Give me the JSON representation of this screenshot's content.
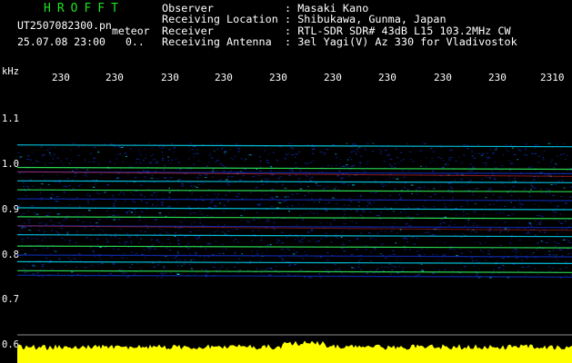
{
  "header": {
    "logo": "HROFFT",
    "filename": "UT2507082300.pn",
    "filetype": "meteor",
    "datetime": "25.07.08 23:00",
    "dots": "0..",
    "info": [
      {
        "label": "Observer",
        "value": ": Masaki Kano"
      },
      {
        "label": "Receiving Location",
        "value": ": Shibukawa, Gunma, Japan"
      },
      {
        "label": "Receiver",
        "value": ": RTL-SDR SDR# 43dB L15 103.2MHz CW"
      },
      {
        "label": "Receiving Antenna",
        "value": ": 3el Yagi(V) Az 330 for Vladivostok"
      }
    ]
  },
  "axes": {
    "y_unit": "kHz",
    "y_labels": [
      "1.1",
      "1.0",
      "0.9",
      "0.8",
      "0.7",
      "0.6"
    ],
    "x_labels": [
      "230",
      "230",
      "230",
      "230",
      "230",
      "230",
      "230",
      "230",
      "230",
      "230",
      "2310"
    ]
  },
  "colors": {
    "logo": "#1fe21f",
    "power_trace": "#ffff00",
    "baseline": "#c8c8c8",
    "signal_cyan": "#00e0ff",
    "signal_green": "#30ff60",
    "signal_red": "#ff3030",
    "noise_blue": "#1030c0"
  },
  "spectrogram": {
    "signal_lines_khz": [
      1.045,
      0.995,
      0.985,
      0.965,
      0.945,
      0.925,
      0.905,
      0.885,
      0.865,
      0.845,
      0.82,
      0.8,
      0.785,
      0.765,
      0.755
    ]
  }
}
